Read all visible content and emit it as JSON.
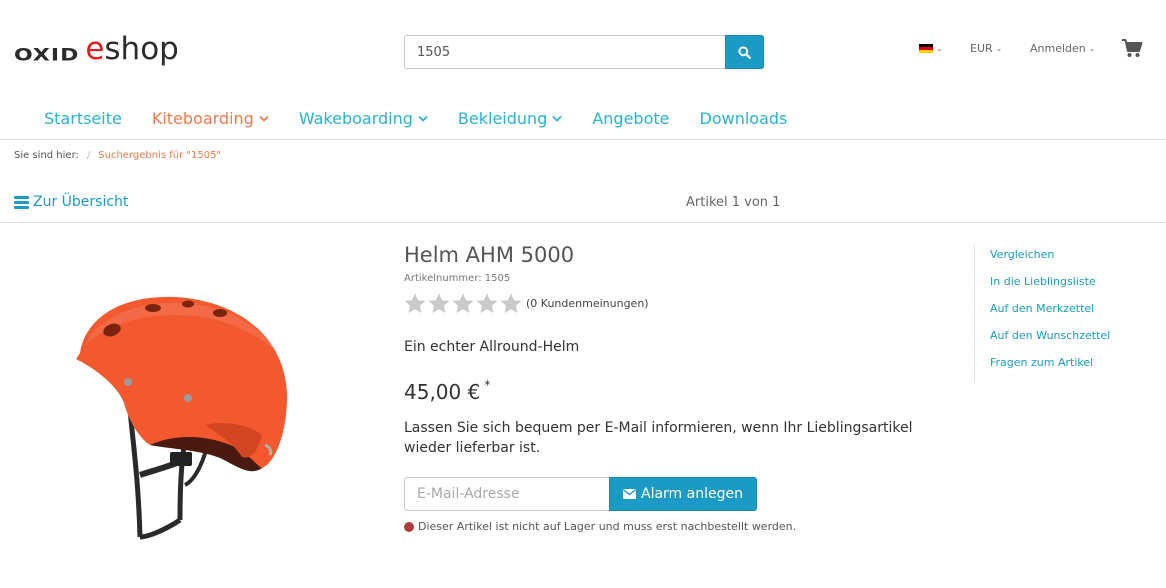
{
  "header": {
    "logo": {
      "part1": "OXID",
      "part2": "e",
      "part3": "shop"
    },
    "search": {
      "value": "1505",
      "placeholder": ""
    },
    "language": {
      "icon": "flag-de-icon"
    },
    "currency": "EUR",
    "login": "Anmelden"
  },
  "nav": {
    "items": [
      {
        "label": "Startseite",
        "dropdown": false
      },
      {
        "label": "Kiteboarding",
        "dropdown": true
      },
      {
        "label": "Wakeboarding",
        "dropdown": true
      },
      {
        "label": "Bekleidung",
        "dropdown": true
      },
      {
        "label": "Angebote",
        "dropdown": false
      },
      {
        "label": "Downloads",
        "dropdown": false
      }
    ]
  },
  "breadcrumb": {
    "prefix": "Sie sind hier:",
    "separator": "/",
    "current": "Suchergebnis für \"1505\""
  },
  "listing": {
    "overview": "Zur Übersicht",
    "pager": "Artikel 1 von 1"
  },
  "product": {
    "title": "Helm AHM 5000",
    "article_number": "Artikelnummer: 1505",
    "rating": {
      "stars": 0,
      "max": 5,
      "count_text": "(0 Kundenmeinungen)"
    },
    "short_description": "Ein echter Allround-Helm",
    "price": "45,00 €",
    "price_note": "*",
    "notify_text": "Lassen Sie sich bequem per E-Mail informieren, wenn Ihr Lieblingsartikel wieder lieferbar ist.",
    "email_placeholder": "E-Mail-Adresse",
    "alarm_button": "Alarm anlegen",
    "stock_text": "Dieser Artikel ist nicht auf Lager und muss erst nachbestellt werden.",
    "image_alt": "Helm AHM 5000"
  },
  "side_links": [
    "Vergleichen",
    "In die Lieblingsliste",
    "Auf den Merkzettel",
    "Auf den Wunschzettel",
    "Fragen zum Artikel"
  ],
  "colors": {
    "accent": "#1a9ac5",
    "nav": "#2ab3cc",
    "active": "#f07a4a",
    "logo_red": "#e02020",
    "stock_red": "#b13b3b",
    "helmet": "#f2592f"
  }
}
